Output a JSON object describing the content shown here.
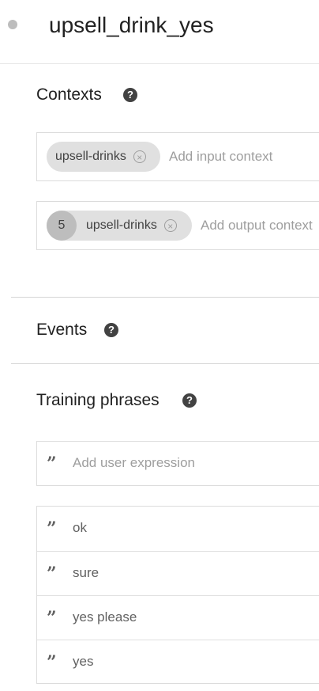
{
  "intent": {
    "title": "upsell_drink_yes"
  },
  "contexts": {
    "title": "Contexts",
    "input": {
      "chip": "upsell-drinks",
      "placeholder": "Add input context"
    },
    "output": {
      "lifespan": "5",
      "chip": "upsell-drinks",
      "placeholder": "Add output context"
    }
  },
  "events": {
    "title": "Events"
  },
  "training_phrases": {
    "title": "Training phrases",
    "input_placeholder": "Add user expression",
    "phrases": [
      "ok",
      "sure",
      "yes please",
      "yes"
    ]
  },
  "icons": {
    "help": "help-circle-icon",
    "quote": "quote-icon",
    "remove": "close-circle-icon"
  },
  "colors": {
    "chip_bg": "#e0e0e0",
    "lifespan_bg": "#bdbdbd",
    "text": "#212121",
    "muted": "#9e9e9e"
  }
}
